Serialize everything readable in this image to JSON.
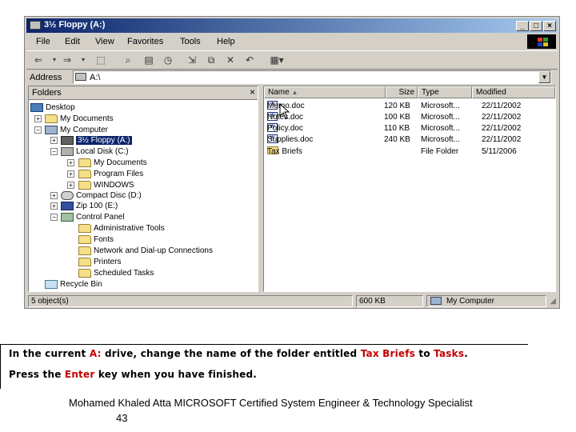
{
  "window": {
    "title": "3½ Floppy (A:)",
    "controls": {
      "minimize": "_",
      "maximize": "□",
      "close": "×"
    }
  },
  "menu": [
    "File",
    "Edit",
    "View",
    "Favorites",
    "Tools",
    "Help"
  ],
  "toolbar_icons": [
    "back-icon",
    "forward-icon",
    "up-folder-icon",
    "search-icon",
    "folders-icon",
    "history-icon",
    "move-to-icon",
    "copy-to-icon",
    "delete-icon",
    "undo-icon",
    "views-icon"
  ],
  "address": {
    "label": "Address",
    "value": "A:\\"
  },
  "folders_pane": {
    "title": "Folders",
    "close": "×",
    "tree": [
      {
        "label": "Desktop",
        "icon": "desktop-icon"
      },
      {
        "label": "My Documents",
        "icon": "folder-icon"
      },
      {
        "label": "My Computer",
        "icon": "computer-icon"
      },
      {
        "label": "3½ Floppy (A:)",
        "icon": "floppy-icon",
        "selected": true
      },
      {
        "label": "Local Disk (C:)",
        "icon": "disk-icon"
      },
      {
        "label": "My Documents",
        "icon": "folder-icon"
      },
      {
        "label": "Program Files",
        "icon": "folder-icon"
      },
      {
        "label": "WINDOWS",
        "icon": "folder-icon"
      },
      {
        "label": "Compact Disc (D:)",
        "icon": "cd-icon"
      },
      {
        "label": "Zip 100  (E:)",
        "icon": "zip-icon"
      },
      {
        "label": "Control Panel",
        "icon": "control-panel-icon"
      },
      {
        "label": "Administrative Tools",
        "icon": "folder-icon"
      },
      {
        "label": "Fonts",
        "icon": "folder-icon"
      },
      {
        "label": "Network and Dial-up Connections",
        "icon": "folder-icon"
      },
      {
        "label": "Printers",
        "icon": "folder-icon"
      },
      {
        "label": "Scheduled Tasks",
        "icon": "folder-icon"
      },
      {
        "label": "Recycle Bin",
        "icon": "recycle-bin-icon"
      }
    ]
  },
  "files_pane": {
    "columns": [
      "Name",
      "Size",
      "Type",
      "Modified"
    ],
    "rows": [
      {
        "name": "Memo.doc",
        "size": "120 KB",
        "type": "Microsoft...",
        "modified": "22/11/2002"
      },
      {
        "name": "Notes.doc",
        "size": "100 KB",
        "type": "Microsoft...",
        "modified": "22/11/2002"
      },
      {
        "name": "Policy.doc",
        "size": "110 KB",
        "type": "Microsoft...",
        "modified": "22/11/2002"
      },
      {
        "name": "Supplies.doc",
        "size": "240 KB",
        "type": "Microsoft...",
        "modified": "22/11/2002"
      },
      {
        "name": "Tax Briefs",
        "size": "",
        "type": "File Folder",
        "modified": "5/11/2006"
      }
    ]
  },
  "status": {
    "objects": "5 object(s)",
    "size": "600 KB",
    "location": "My Computer"
  },
  "instructions": {
    "l1_a": "In the current ",
    "l1_drive": "A:",
    "l1_b": " drive, change the name of the folder entitled ",
    "l1_old": "Tax Briefs",
    "l1_c": " to ",
    "l1_new": "Tasks",
    "l1_d": ".",
    "l2_a": "Press the ",
    "l2_key": "Enter",
    "l2_b": " key when you have finished."
  },
  "footer": {
    "credit": "Mohamed Khaled Atta MICROSOFT Certified System Engineer & Technology Specialist",
    "page": "43"
  },
  "colors": {
    "title_start": "#0a246a",
    "title_end": "#a6caf0",
    "highlight": "#c00000",
    "chrome": "#d4d0c8"
  }
}
